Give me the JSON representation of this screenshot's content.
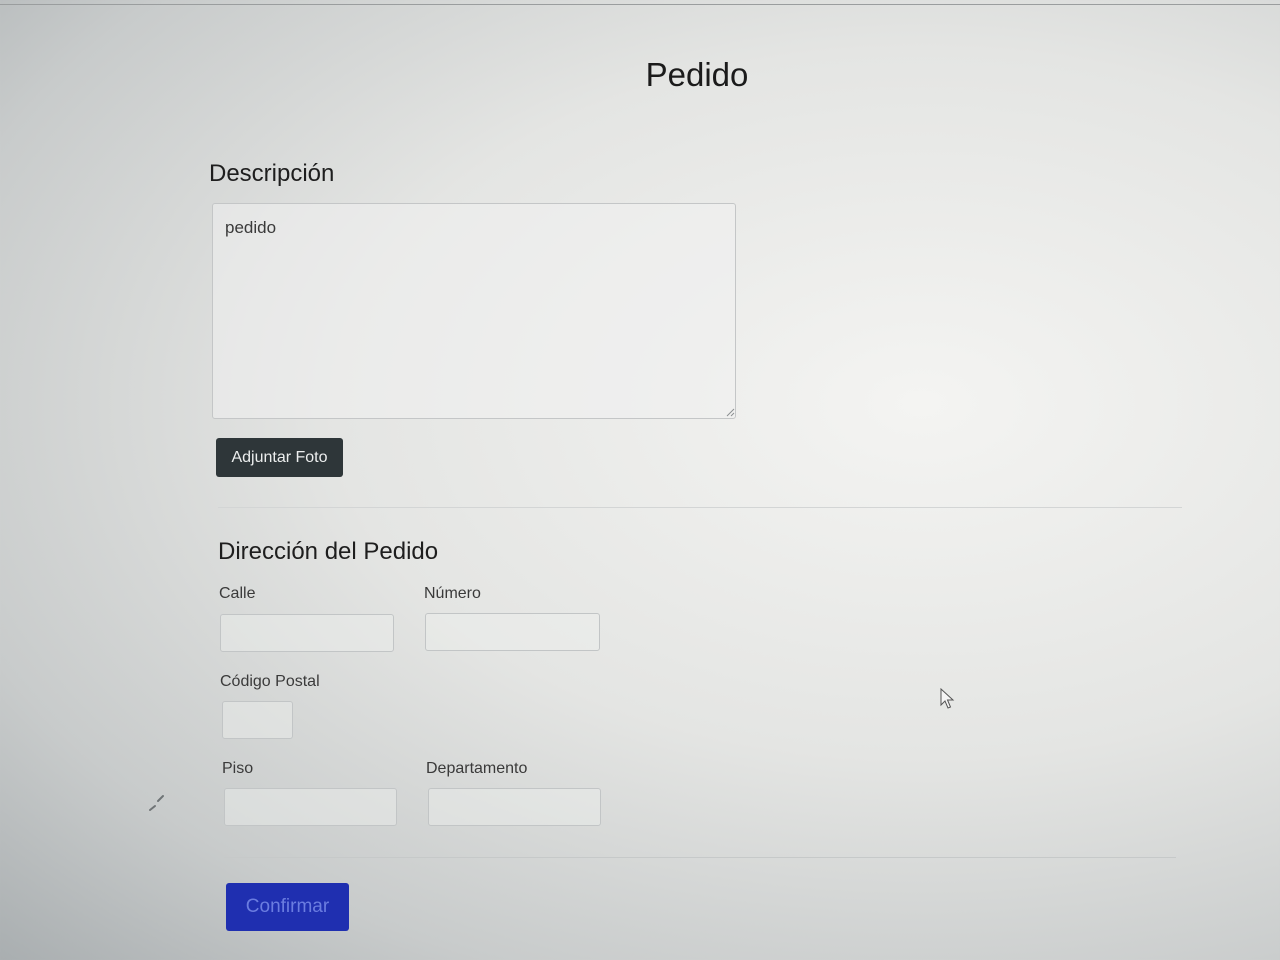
{
  "page": {
    "title": "Pedido"
  },
  "description": {
    "heading": "Descripción",
    "value": "pedido",
    "attach_button": "Adjuntar Foto"
  },
  "address": {
    "heading": "Dirección del Pedido",
    "street_label": "Calle",
    "street_value": "",
    "number_label": "Número",
    "number_value": "",
    "postal_label": "Código Postal",
    "postal_value": "",
    "floor_label": "Piso",
    "floor_value": "",
    "apartment_label": "Departamento",
    "apartment_value": ""
  },
  "actions": {
    "confirm_button": "Confirmar"
  },
  "colors": {
    "dark_button": "#2e3639",
    "primary_button": "#1f2fb0",
    "primary_button_text": "#6b7de0",
    "border": "#c4c6c7"
  },
  "icons": {
    "cursor": "mouse-pointer-icon",
    "resize": "resize-grip-icon"
  }
}
